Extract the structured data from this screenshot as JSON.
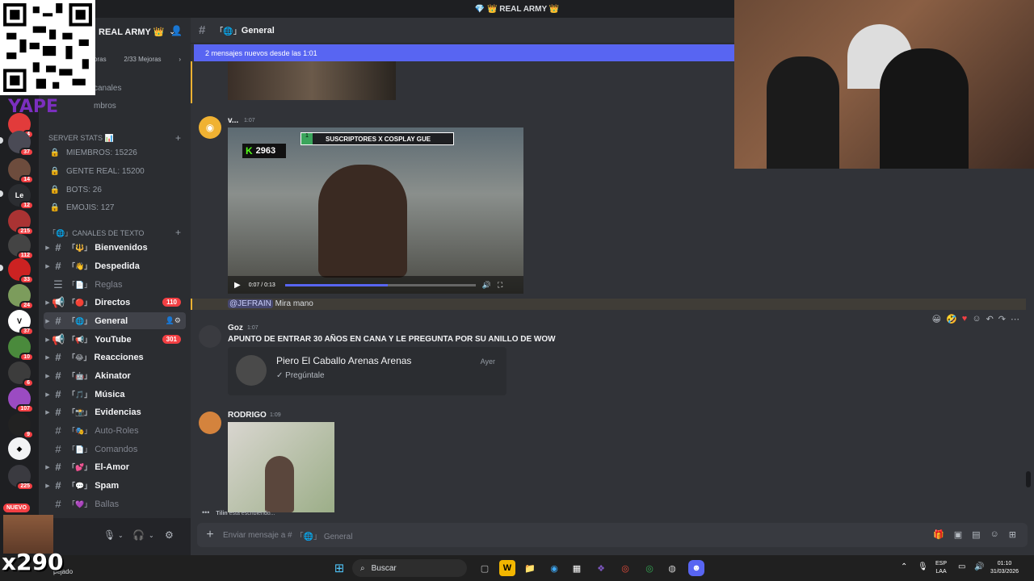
{
  "window_title": "💎 👑 REAL ARMY 👑",
  "server": {
    "name": "REAL ARMY 👑",
    "boost_label": "oras",
    "boost_count": "2/33 Mejoras",
    "channels_browse": "canales",
    "members_link": "mbros"
  },
  "rail": {
    "badges": [
      "4",
      "37",
      "14",
      "12",
      "215",
      "112",
      "33",
      "24",
      "37",
      "10",
      "6",
      "107",
      "9",
      "225"
    ],
    "new_label": "NUEVO"
  },
  "stats_category": "SERVER STATS 📊",
  "stats": [
    {
      "label": "MIEMBROS: 15226"
    },
    {
      "label": "GENTE REAL: 15200"
    },
    {
      "label": "BOTS: 26"
    },
    {
      "label": "EMOJIS: 127"
    }
  ],
  "text_category": "「🌐」CANALES DE TEXTO",
  "channels": [
    {
      "prefix": "「🔱」",
      "name": "Bienvenidos",
      "count": "",
      "muted": false
    },
    {
      "prefix": "「👋」",
      "name": "Despedida",
      "count": "",
      "muted": false
    },
    {
      "prefix": "「📄」",
      "name": "Reglas",
      "count": "",
      "muted": true
    },
    {
      "prefix": "「🔴」",
      "name": "Directos",
      "count": "110",
      "muted": false
    },
    {
      "prefix": "「🌐」",
      "name": "General",
      "count": "",
      "muted": false
    },
    {
      "prefix": "「📢」",
      "name": "YouTube",
      "count": "301",
      "muted": false
    },
    {
      "prefix": "「😂」",
      "name": "Reacciones",
      "count": "",
      "muted": false
    },
    {
      "prefix": "「🤖」",
      "name": "Akinator",
      "count": "",
      "muted": false
    },
    {
      "prefix": "「🎵」",
      "name": "Música",
      "count": "",
      "muted": false
    },
    {
      "prefix": "「📸」",
      "name": "Evidencias",
      "count": "",
      "muted": false
    },
    {
      "prefix": "「🎭」",
      "name": "Auto-Roles",
      "count": "",
      "muted": true
    },
    {
      "prefix": "「📄」",
      "name": "Comandos",
      "count": "",
      "muted": true
    },
    {
      "prefix": "「💕」",
      "name": "El-Amor",
      "count": "",
      "muted": false
    },
    {
      "prefix": "「💬」",
      "name": "Spam",
      "count": "",
      "muted": false
    },
    {
      "prefix": "「💜」",
      "name": "Ballas",
      "count": "",
      "muted": true
    }
  ],
  "chat": {
    "header_prefix": "「🌐」",
    "header_name": "General",
    "new_messages_bar": "2 mensajes nuevos desde las 1:01",
    "msg1": {
      "author": "v...",
      "time": "1:07",
      "overlay_banner": "SUSCRIPTORES X COSPLAY GUE",
      "overlay_count": "2963",
      "video_time": "0:07 / 0:13",
      "reply_mention": "@JEFRAIN",
      "reply_text": "Mira mano"
    },
    "msg2": {
      "author": "Goz",
      "time": "1:07",
      "text": "APUNTO DE ENTRAR 30 AÑOS EN CANA Y LE PREGUNTA POR SU ANILLO DE WOW",
      "embed_title": "Piero El Caballo Arenas Arenas",
      "embed_sub": "✓ Pregúntale",
      "embed_time": "Ayer"
    },
    "msg3": {
      "author": "RODRIGO",
      "time": "1:09"
    },
    "typing_user": "Tilin",
    "typing_text": "está escribiendo...",
    "composer_placeholder_prefix": "Enviar mensaje a #",
    "composer_channel": "「🌐」 General"
  },
  "overlay": {
    "yape": "YAPE",
    "x290": "x290"
  },
  "taskbar": {
    "search": "Buscar",
    "weather": "pejado",
    "lang_top": "ESP",
    "lang_bottom": "LAA",
    "clock_time": "01:10",
    "clock_date": "31/03/2026"
  },
  "colors": {
    "accent": "#5865f2",
    "badge": "#f23f43",
    "bg_chat": "#313338",
    "bg_sidebar": "#2b2d31"
  }
}
